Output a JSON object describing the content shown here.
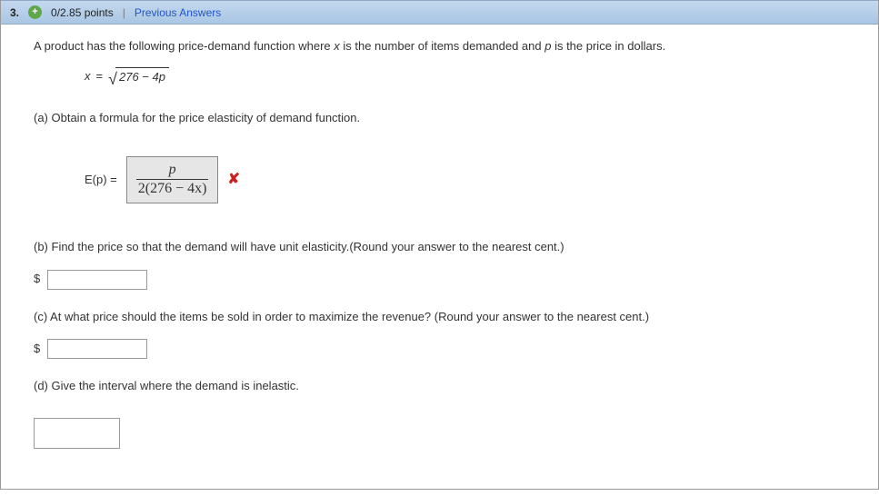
{
  "header": {
    "question_number": "3.",
    "plus_glyph": "+",
    "points": "0/2.85 points",
    "divider": "|",
    "previous_answers": "Previous Answers"
  },
  "intro": {
    "text_before_x": "A product has the following price-demand function where ",
    "var_x": "x",
    "text_mid": " is the number of items demanded and ",
    "var_p": "p",
    "text_after": " is the price in dollars."
  },
  "formula": {
    "lhs_var": "x",
    "equals": " = ",
    "sqrt_content": "276 − 4p"
  },
  "part_a": {
    "label": "(a) Obtain a formula for the price elasticity of demand function.",
    "ep_label": "E(p) = ",
    "frac_num": "p",
    "frac_den": "2(276 − 4x)",
    "x_mark": "✘"
  },
  "part_b": {
    "label": "(b) Find the price so that the demand will have unit elasticity.(Round your answer to the nearest cent.)",
    "dollar": "$",
    "value": ""
  },
  "part_c": {
    "label": "(c) At what price should the items be sold in order to maximize the revenue? (Round your answer to the nearest cent.)",
    "dollar": "$",
    "value": ""
  },
  "part_d": {
    "label": "(d) Give the interval where the demand is inelastic.",
    "value": ""
  }
}
